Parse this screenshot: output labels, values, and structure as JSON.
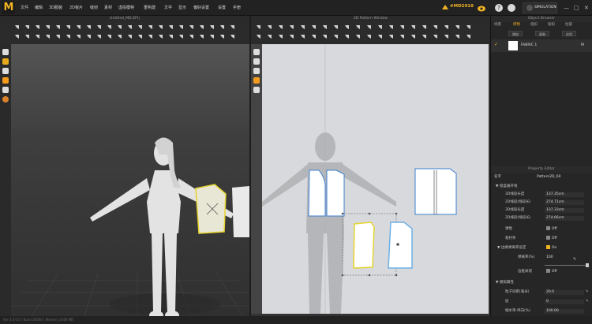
{
  "app": {
    "logo": "M",
    "menu": [
      "文件",
      "编辑",
      "3D服装",
      "2D板片",
      "缝纫",
      "素材",
      "虚拟模特",
      "重构建",
      "文字",
      "显示",
      "偏好设置",
      "设置",
      "手册"
    ],
    "badge": "#MD2018",
    "simulation_label": "SIMULATION",
    "help_glyph": "?",
    "winbtns": [
      "—",
      "□",
      "✕"
    ]
  },
  "panel3d": {
    "title": "Untitled_MD.ZPrj"
  },
  "panel2d": {
    "title": "2D Pattern Window"
  },
  "object_browser": {
    "title": "Object Browser",
    "tabs": [
      "场景",
      "织物",
      "纽扣",
      "按扣",
      "拉链"
    ],
    "add_label": "增加",
    "copy_label": "复制",
    "apply_label": "应用",
    "fabric_name": "FABRIC 1",
    "fabric_count": "M"
  },
  "property_editor": {
    "title": "Property Editor",
    "name_key": "名字",
    "name_value": "Pattern2D_60",
    "section_main": "▼ 纸盒展开线",
    "rows": [
      {
        "k": "3D线段长度",
        "v": "137.35cm"
      },
      {
        "k": "2D线段(线段长)",
        "v": "274.71cm"
      },
      {
        "k": "3D线段长度",
        "v": "137.33cm"
      },
      {
        "k": "2D线段(线段长)",
        "v": "274.66cm"
      }
    ],
    "toggle_rows": [
      {
        "k": "弹性",
        "v": "Off"
      },
      {
        "k": "粘衬条",
        "v": "Off"
      },
      {
        "k": "▼ 边缘弹离率设定",
        "v": "On"
      }
    ],
    "ratio_key": "弹离率(%)",
    "ratio_value": "100",
    "fold_key": "边框表现",
    "fold_value": "Off",
    "section_sim": "▼ 模拟属性",
    "particle_key": "粒子间距(毫米)",
    "particle_value": "20.0",
    "layer_key": "层",
    "layer_value": "0",
    "shrink_key": "缩水率-纬向(%)",
    "shrink_value": "100.00"
  },
  "status": {
    "text": "Ver 4.0.0.0 / Build 30000 | Memory 2048 MB"
  },
  "colors": {
    "accent": "#f0b323",
    "selected_pattern": "#e6d430",
    "pattern_outline": "#3b7fd1"
  }
}
